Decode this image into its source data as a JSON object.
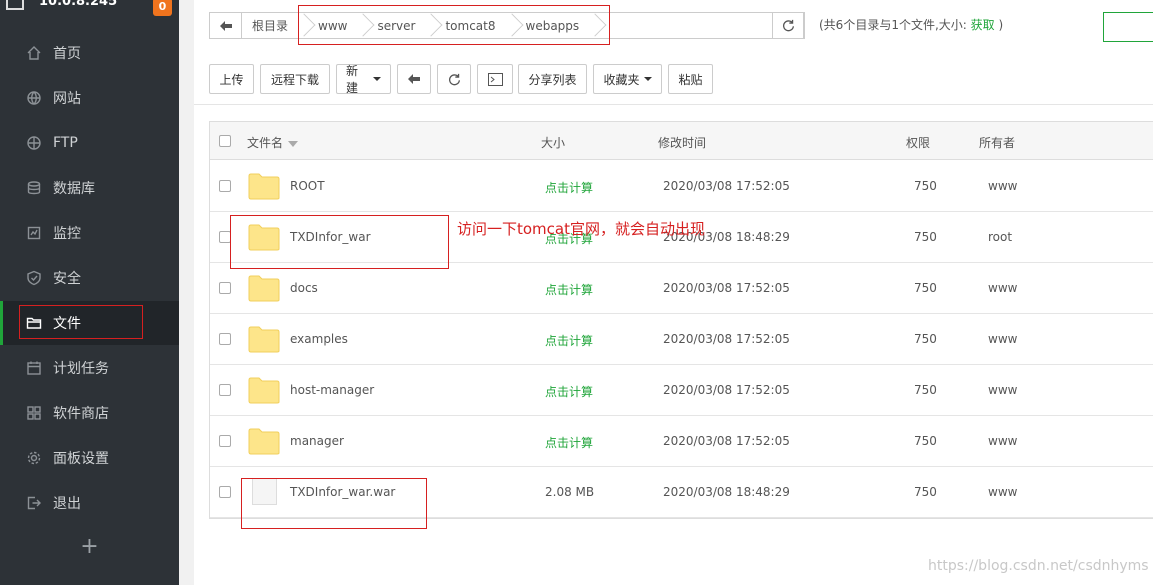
{
  "sidebar": {
    "server_ip": "10.0.8.245",
    "badge_count": "0",
    "items": [
      {
        "label": "首页",
        "icon": "home-icon"
      },
      {
        "label": "网站",
        "icon": "globe-icon"
      },
      {
        "label": "FTP",
        "icon": "ftp-icon"
      },
      {
        "label": "数据库",
        "icon": "database-icon"
      },
      {
        "label": "监控",
        "icon": "monitor-icon"
      },
      {
        "label": "安全",
        "icon": "shield-icon"
      },
      {
        "label": "文件",
        "icon": "folder-icon"
      },
      {
        "label": "计划任务",
        "icon": "calendar-icon"
      },
      {
        "label": "软件商店",
        "icon": "apps-icon"
      },
      {
        "label": "面板设置",
        "icon": "gear-icon"
      },
      {
        "label": "退出",
        "icon": "logout-icon"
      }
    ],
    "active_item": "文件",
    "add_label": "+"
  },
  "path_bar": {
    "crumbs": [
      "根目录",
      "www",
      "server",
      "tomcat8",
      "webapps"
    ]
  },
  "dir_info": {
    "text": "(共6个目录与1个文件,大小:",
    "link": "获取",
    "suffix": ")"
  },
  "toolbar": {
    "upload": "上传",
    "remote_download": "远程下载",
    "new": "新建",
    "share_list": "分享列表",
    "favorites": "收藏夹",
    "paste": "粘贴"
  },
  "table": {
    "headers": {
      "name": "文件名",
      "size": "大小",
      "modified": "修改时间",
      "perm": "权限",
      "owner": "所有者"
    },
    "rows": [
      {
        "name": "ROOT",
        "type": "folder",
        "size": "点击计算",
        "modified": "2020/03/08 17:52:05",
        "perm": "750",
        "owner": "www"
      },
      {
        "name": "TXDInfor_war",
        "type": "folder",
        "size": "点击计算",
        "modified": "2020/03/08 18:48:29",
        "perm": "750",
        "owner": "root"
      },
      {
        "name": "docs",
        "type": "folder",
        "size": "点击计算",
        "modified": "2020/03/08 17:52:05",
        "perm": "750",
        "owner": "www"
      },
      {
        "name": "examples",
        "type": "folder",
        "size": "点击计算",
        "modified": "2020/03/08 17:52:05",
        "perm": "750",
        "owner": "www"
      },
      {
        "name": "host-manager",
        "type": "folder",
        "size": "点击计算",
        "modified": "2020/03/08 17:52:05",
        "perm": "750",
        "owner": "www"
      },
      {
        "name": "manager",
        "type": "folder",
        "size": "点击计算",
        "modified": "2020/03/08 17:52:05",
        "perm": "750",
        "owner": "www"
      },
      {
        "name": "TXDInfor_war.war",
        "type": "file",
        "size": "2.08 MB",
        "modified": "2020/03/08 18:48:29",
        "perm": "750",
        "owner": "www"
      }
    ]
  },
  "annotation": "访问一下tomcat官网，就会自动出现",
  "watermark": "https://blog.csdn.net/csdnhyms",
  "colors": {
    "accent": "#20a53a",
    "sidebar_bg": "#2d3237",
    "badge": "#f0741e",
    "annotation": "#d62020"
  }
}
